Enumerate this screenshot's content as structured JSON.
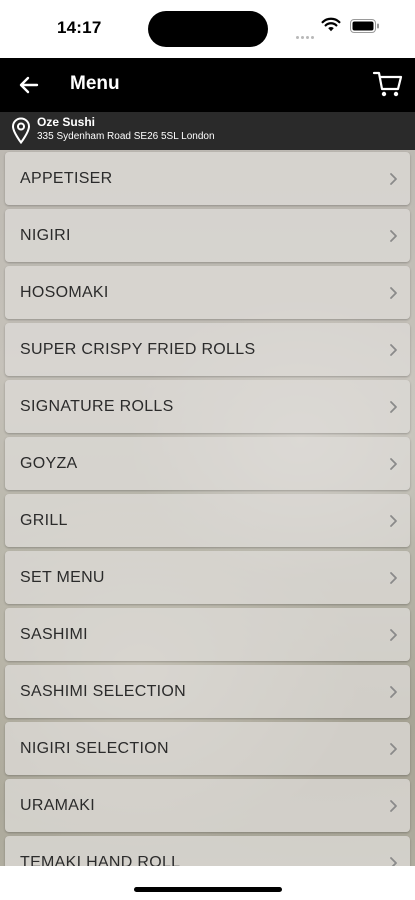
{
  "status_bar": {
    "time": "14:17"
  },
  "header": {
    "title": "Menu",
    "back_icon": "arrow-left-icon",
    "cart_icon": "shopping-cart-icon"
  },
  "location": {
    "name": "Oze Sushi",
    "address": "335 Sydenham Road SE26 5SL London",
    "icon": "map-pin-icon"
  },
  "menu": {
    "items": [
      {
        "label": "APPETISER"
      },
      {
        "label": "NIGIRI"
      },
      {
        "label": "HOSOMAKI"
      },
      {
        "label": "SUPER CRISPY FRIED ROLLS"
      },
      {
        "label": "SIGNATURE ROLLS"
      },
      {
        "label": "GOYZA"
      },
      {
        "label": "GRILL"
      },
      {
        "label": "SET MENU"
      },
      {
        "label": "SASHIMI"
      },
      {
        "label": "SASHIMI SELECTION"
      },
      {
        "label": "NIGIRI SELECTION"
      },
      {
        "label": "URAMAKI"
      },
      {
        "label": "TEMAKI HAND ROLL"
      }
    ]
  },
  "colors": {
    "header_bg": "#000000",
    "location_bg": "#2a2a2a",
    "item_text": "#2b2b2b"
  }
}
